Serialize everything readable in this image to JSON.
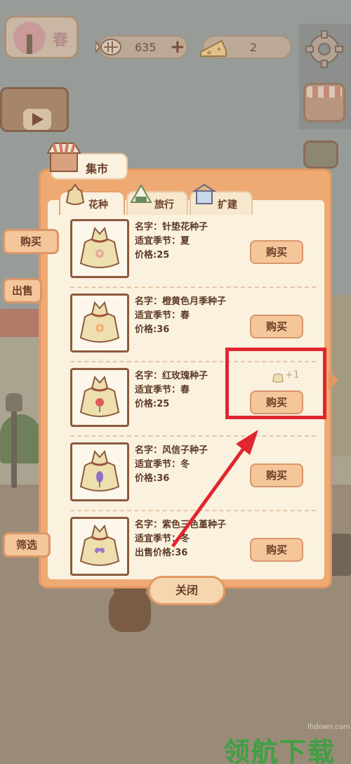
{
  "hud": {
    "season": "春",
    "coins": "635",
    "coins_plus": "+",
    "cheese": "2"
  },
  "market": {
    "title": "集市",
    "tabs": [
      {
        "label": "花种",
        "active": true,
        "icon": "seed-bag-icon"
      },
      {
        "label": "旅行",
        "active": false,
        "icon": "rice-ball-icon"
      },
      {
        "label": "扩建",
        "active": false,
        "icon": "building-icon"
      }
    ],
    "side_buttons": {
      "buy": "购买",
      "sell": "出售",
      "filter": "筛选"
    },
    "close_label": "关闭",
    "items": [
      {
        "name": "名字：针垫花种子",
        "season": "适宜季节：夏",
        "price": "价格:25",
        "buy": "购买",
        "flower_color": "#e7a6a6"
      },
      {
        "name": "名字：橙黄色月季种子",
        "season": "适宜季节：春",
        "price": "价格:36",
        "buy": "购买",
        "flower_color": "#f0b27a"
      },
      {
        "name": "名字：红玫瑰种子",
        "season": "适宜季节：春",
        "price": "价格:25",
        "buy": "购买",
        "flower_color": "#e35b5b",
        "badge": "+1"
      },
      {
        "name": "名字：风信子种子",
        "season": "适宜季节：冬",
        "price": "价格:36",
        "buy": "购买",
        "flower_color": "#8e6fc6"
      },
      {
        "name": "名字：紫色三色堇种子",
        "season": "适宜季节：冬",
        "price": "出售价格:36",
        "buy": "购买",
        "flower_color": "#9a79c8"
      }
    ]
  },
  "watermark": {
    "site": "lhdown.com",
    "text": "领航下载"
  },
  "colors": {
    "dialog_border": "#efaa74",
    "panel_bg": "#fbf1df",
    "button_fill": "#f4c69a",
    "text_brown": "#6b3f2a",
    "annotation_red": "#e0262e",
    "watermark_green": "#3ea043"
  }
}
